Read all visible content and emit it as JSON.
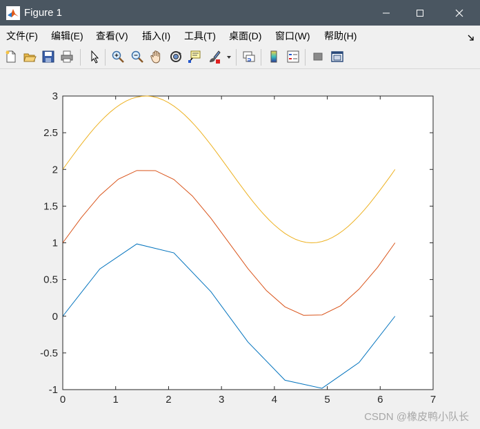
{
  "window": {
    "title": "Figure 1"
  },
  "menu": [
    {
      "label": "文件(F)"
    },
    {
      "label": "编辑(E)"
    },
    {
      "label": "查看(V)"
    },
    {
      "label": "插入(I)"
    },
    {
      "label": "工具(T)"
    },
    {
      "label": "桌面(D)"
    },
    {
      "label": "窗口(W)"
    },
    {
      "label": "帮助(H)"
    }
  ],
  "toolbar": {
    "icons": [
      "new-figure-icon",
      "open-file-icon",
      "save-icon",
      "print-icon",
      "edit-plot-icon",
      "zoom-in-icon",
      "zoom-out-icon",
      "pan-icon",
      "rotate-3d-icon",
      "data-cursor-icon",
      "brush-icon",
      "link-plot-icon",
      "insert-colorbar-icon",
      "insert-legend-icon",
      "hide-plot-tools-icon",
      "show-plot-tools-icon"
    ]
  },
  "chart_data": {
    "type": "line",
    "title": "",
    "xlabel": "",
    "ylabel": "",
    "xlim": [
      0,
      7
    ],
    "ylim": [
      -1,
      3
    ],
    "xticks": [
      0,
      1,
      2,
      3,
      4,
      5,
      6,
      7
    ],
    "yticks": [
      -1,
      -0.5,
      0,
      0.5,
      1,
      1.5,
      2,
      2.5,
      3
    ],
    "grid": false,
    "series": [
      {
        "color": "#0072bd",
        "x": [
          0,
          0.7,
          1.4,
          2.1,
          2.8,
          3.5,
          4.2,
          4.9,
          5.6,
          6.28
        ],
        "y": [
          0,
          0.644,
          0.985,
          0.863,
          0.335,
          -0.351,
          -0.872,
          -0.982,
          -0.631,
          0
        ]
      },
      {
        "color": "#d95319",
        "x": [
          0,
          0.35,
          0.7,
          1.05,
          1.4,
          1.75,
          2.1,
          2.45,
          2.8,
          3.15,
          3.5,
          3.85,
          4.2,
          4.55,
          4.9,
          5.25,
          5.6,
          5.95,
          6.28
        ],
        "y": [
          1,
          1.343,
          1.644,
          1.867,
          1.985,
          1.984,
          1.863,
          1.638,
          1.335,
          0.992,
          0.649,
          0.349,
          0.128,
          0.013,
          0.018,
          0.142,
          0.369,
          0.665,
          1
        ]
      },
      {
        "color": "#edb120",
        "x": [
          0,
          0.1,
          0.2,
          0.3,
          0.4,
          0.5,
          0.6,
          0.7,
          0.8,
          0.9,
          1.0,
          1.1,
          1.2,
          1.3,
          1.4,
          1.5,
          1.6,
          1.7,
          1.8,
          1.9,
          2.0,
          2.1,
          2.2,
          2.3,
          2.4,
          2.5,
          2.6,
          2.7,
          2.8,
          2.9,
          3.0,
          3.1,
          3.2,
          3.3,
          3.4,
          3.5,
          3.6,
          3.7,
          3.8,
          3.9,
          4.0,
          4.1,
          4.2,
          4.3,
          4.4,
          4.5,
          4.6,
          4.7,
          4.8,
          4.9,
          5.0,
          5.1,
          5.2,
          5.3,
          5.4,
          5.5,
          5.6,
          5.7,
          5.8,
          5.9,
          6.0,
          6.1,
          6.2,
          6.28
        ],
        "y": [
          2,
          2.1,
          2.199,
          2.296,
          2.389,
          2.479,
          2.565,
          2.644,
          2.717,
          2.783,
          2.841,
          2.891,
          2.932,
          2.964,
          2.985,
          2.997,
          3.0,
          2.992,
          2.974,
          2.946,
          2.909,
          2.863,
          2.808,
          2.746,
          2.675,
          2.598,
          2.516,
          2.427,
          2.335,
          2.239,
          2.141,
          2.042,
          1.942,
          1.842,
          1.745,
          1.649,
          1.557,
          1.47,
          1.388,
          1.312,
          1.243,
          1.182,
          1.128,
          1.084,
          1.048,
          1.022,
          1.006,
          1.0,
          1.004,
          1.018,
          1.041,
          1.075,
          1.117,
          1.168,
          1.227,
          1.295,
          1.369,
          1.449,
          1.535,
          1.626,
          1.721,
          1.818,
          1.917,
          2.0
        ]
      }
    ]
  },
  "watermark": "CSDN @橡皮鸭小队长"
}
